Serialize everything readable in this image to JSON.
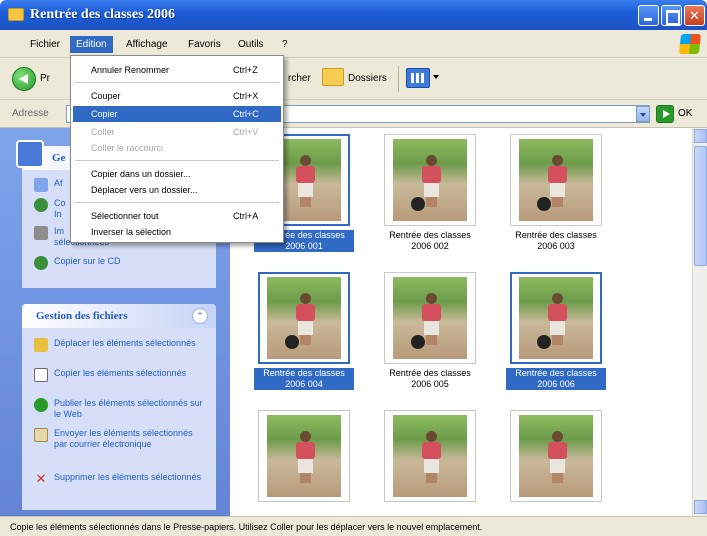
{
  "window": {
    "title": "Rentrée des classes 2006"
  },
  "menubar": {
    "items": [
      "Fichier",
      "Edition",
      "Affichage",
      "Favoris",
      "Outils",
      "?"
    ]
  },
  "toolbar": {
    "back_label": "Pr",
    "search_label": "rcher",
    "folders_label": "Dossiers"
  },
  "address": {
    "label": "Adresse",
    "go_label": "OK"
  },
  "edit_menu": {
    "items": [
      {
        "label": "Annuler Renommer",
        "shortcut": "Ctrl+Z",
        "state": "normal"
      },
      {
        "label": "Couper",
        "shortcut": "Ctrl+X",
        "state": "normal"
      },
      {
        "label": "Copier",
        "shortcut": "Ctrl+C",
        "state": "highlighted"
      },
      {
        "label": "Coller",
        "shortcut": "Ctrl+V",
        "state": "disabled"
      },
      {
        "label": "Coller le raccourci",
        "shortcut": "",
        "state": "disabled"
      },
      {
        "label": "Copier dans un dossier...",
        "shortcut": "",
        "state": "normal"
      },
      {
        "label": "Déplacer vers un dossier...",
        "shortcut": "",
        "state": "normal"
      },
      {
        "label": "Sélectionner tout",
        "shortcut": "Ctrl+A",
        "state": "normal"
      },
      {
        "label": "Inverser la sélection",
        "shortcut": "",
        "state": "normal"
      }
    ]
  },
  "picture_tasks": {
    "title": "Ge",
    "items": [
      {
        "label": "Af"
      },
      {
        "label": "Co\nIn"
      },
      {
        "label": "Im\nsélectionnées"
      },
      {
        "label": "Copier sur le CD"
      }
    ]
  },
  "file_tasks": {
    "title": "Gestion des fichiers",
    "items": [
      {
        "label": "Déplacer les éléments sélectionnés"
      },
      {
        "label": "Copier les éléments sélectionnés"
      },
      {
        "label": "Publier les éléments sélectionnés sur le Web"
      },
      {
        "label": "Envoyer les éléments sélectionnés par courrier électronique"
      },
      {
        "label": "Supprimer les éléments sélectionnés"
      }
    ]
  },
  "thumbnails": [
    {
      "caption": "Rentrée des classes 2006 001",
      "selected": true
    },
    {
      "caption": "Rentrée des classes 2006 002",
      "selected": false
    },
    {
      "caption": "Rentrée des classes 2006 003",
      "selected": false
    },
    {
      "caption": "Rentrée des classes 2006 004",
      "selected": true
    },
    {
      "caption": "Rentrée des classes 2006 005",
      "selected": false
    },
    {
      "caption": "Rentrée des classes 2006 006",
      "selected": true
    },
    {
      "caption": "",
      "selected": false
    },
    {
      "caption": "",
      "selected": false
    },
    {
      "caption": "",
      "selected": false
    }
  ],
  "statusbar": {
    "text": "Copie les éléments sélectionnés dans le Presse-papiers. Utilisez Coller pour les déplacer vers le nouvel emplacement."
  },
  "colors": {
    "selection": "#316ac5",
    "taskpane": "#6e93df",
    "titlebar": "#2462d8"
  }
}
